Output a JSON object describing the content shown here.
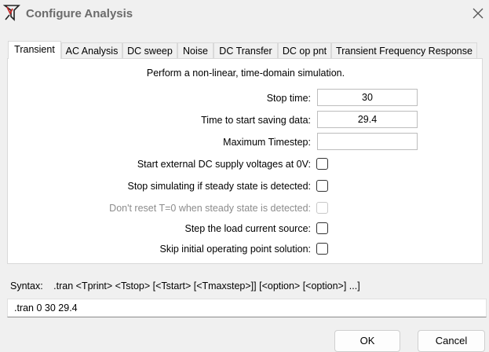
{
  "window": {
    "title": "Configure Analysis",
    "icon": "ltspice-app-icon",
    "close_icon": "close-icon"
  },
  "tabs": [
    {
      "label": "Transient",
      "active": true
    },
    {
      "label": "AC Analysis"
    },
    {
      "label": "DC sweep"
    },
    {
      "label": "Noise"
    },
    {
      "label": "DC Transfer"
    },
    {
      "label": "DC op pnt"
    },
    {
      "label": "Transient Frequency Response"
    }
  ],
  "transient": {
    "intro": "Perform a non-linear, time-domain simulation.",
    "stop_time": {
      "label": "Stop time:",
      "value": "30"
    },
    "start_saving": {
      "label": "Time to start saving data:",
      "value": "29.4"
    },
    "max_timestep": {
      "label": "Maximum Timestep:",
      "value": ""
    },
    "options": [
      {
        "label": "Start external DC supply voltages at 0V:",
        "checked": false,
        "enabled": true
      },
      {
        "label": "Stop simulating if steady state is detected:",
        "checked": false,
        "enabled": true
      },
      {
        "label": "Don't reset T=0 when steady state is detected:",
        "checked": false,
        "enabled": false
      },
      {
        "label": "Step the load current source:",
        "checked": false,
        "enabled": true
      },
      {
        "label": "Skip initial operating point solution:",
        "checked": false,
        "enabled": true
      }
    ]
  },
  "syntax": {
    "label": "Syntax:",
    "text": ".tran <Tprint> <Tstop> [<Tstart> [<Tmaxstep>]] [<option> [<option>] ...]"
  },
  "command": ".tran 0 30 29.4",
  "buttons": {
    "ok": "OK",
    "cancel": "Cancel"
  }
}
